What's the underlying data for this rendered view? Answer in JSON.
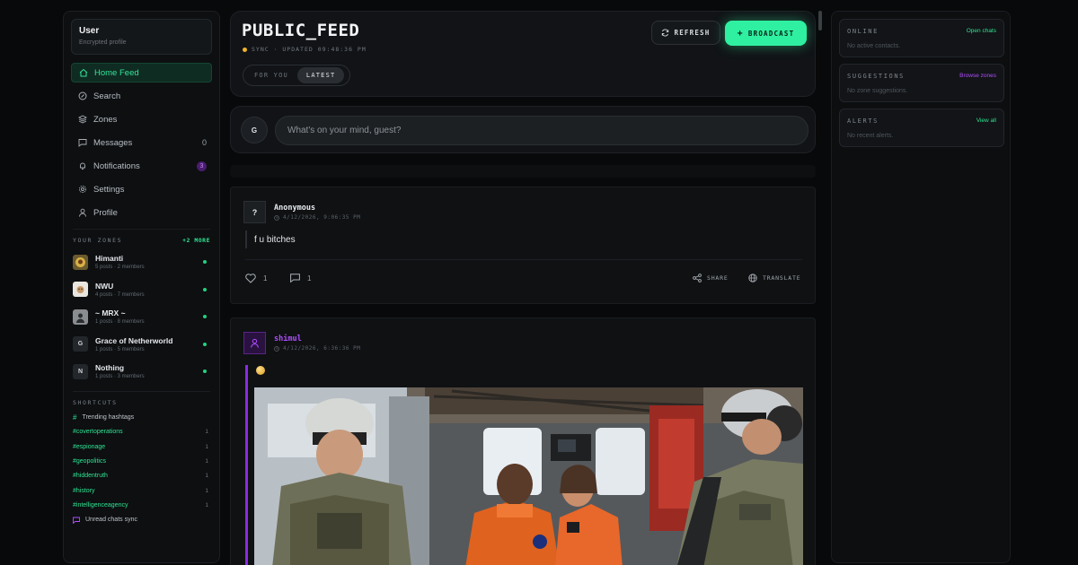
{
  "user": {
    "name": "User",
    "subtitle": "Encrypted profile"
  },
  "nav": [
    {
      "label": "Home Feed",
      "icon": "home-icon",
      "active": true,
      "count": ""
    },
    {
      "label": "Search",
      "icon": "search-icon",
      "active": false,
      "count": ""
    },
    {
      "label": "Zones",
      "icon": "zones-icon",
      "active": false,
      "count": ""
    },
    {
      "label": "Messages",
      "icon": "message-icon",
      "active": false,
      "count": "0"
    },
    {
      "label": "Notifications",
      "icon": "bell-icon",
      "active": false,
      "badge": "3"
    },
    {
      "label": "Settings",
      "icon": "gear-icon",
      "active": false,
      "count": ""
    },
    {
      "label": "Profile",
      "icon": "user-icon",
      "active": false,
      "count": ""
    }
  ],
  "zones": {
    "heading": "YOUR ZONES",
    "more": "+2 MORE",
    "items": [
      {
        "name": "Himanti",
        "meta": "5 posts · 2 members",
        "initial": ""
      },
      {
        "name": "NWU",
        "meta": "4 posts · 7 members",
        "initial": ""
      },
      {
        "name": "~ MRX ~",
        "meta": "1 posts · 8 members",
        "initial": ""
      },
      {
        "name": "Grace of Netherworld",
        "meta": "1 posts · 5 members",
        "initial": "G"
      },
      {
        "name": "Nothing",
        "meta": "1 posts · 3 members",
        "initial": "N"
      }
    ]
  },
  "shortcuts": {
    "heading": "SHORTCUTS",
    "trending": "Trending hashtags",
    "tags": [
      {
        "tag": "#covertoperations",
        "count": "1"
      },
      {
        "tag": "#espionage",
        "count": "1"
      },
      {
        "tag": "#geopolitics",
        "count": "1"
      },
      {
        "tag": "#hiddentruth",
        "count": "1"
      },
      {
        "tag": "#history",
        "count": "1"
      },
      {
        "tag": "#intelligenceagency",
        "count": "1"
      }
    ],
    "unread": "Unread chats sync"
  },
  "header": {
    "title": "PUBLIC_FEED",
    "sync": "SYNC · UPDATED 09:48:36 PM",
    "tabs": [
      "FOR YOU",
      "LATEST"
    ],
    "refresh_label": "REFRESH",
    "broadcast_label": "BROADCAST"
  },
  "composer": {
    "avatar": "G",
    "placeholder": "What's on your mind, guest?"
  },
  "posts": [
    {
      "author": "Anonymous",
      "avatar": "?",
      "time": "4/12/2026, 9:06:35 PM",
      "body": "f u bitches",
      "likes": "1",
      "comments": "1",
      "share_label": "SHARE",
      "translate_label": "TRANSLATE"
    },
    {
      "author": "shimul",
      "time": "4/12/2026, 6:36:36 PM"
    }
  ],
  "right": {
    "online": {
      "title": "ONLINE",
      "link": "Open chats",
      "sub": "No active contacts."
    },
    "suggestions": {
      "title": "SUGGESTIONS",
      "link": "Browse zones",
      "sub": "No zone suggestions."
    },
    "alerts": {
      "title": "ALERTS",
      "link": "View all",
      "sub": "No recent alerts."
    }
  },
  "colors": {
    "accent": "#2ff0a0",
    "purple": "#b04dff",
    "background": "#08090a"
  }
}
